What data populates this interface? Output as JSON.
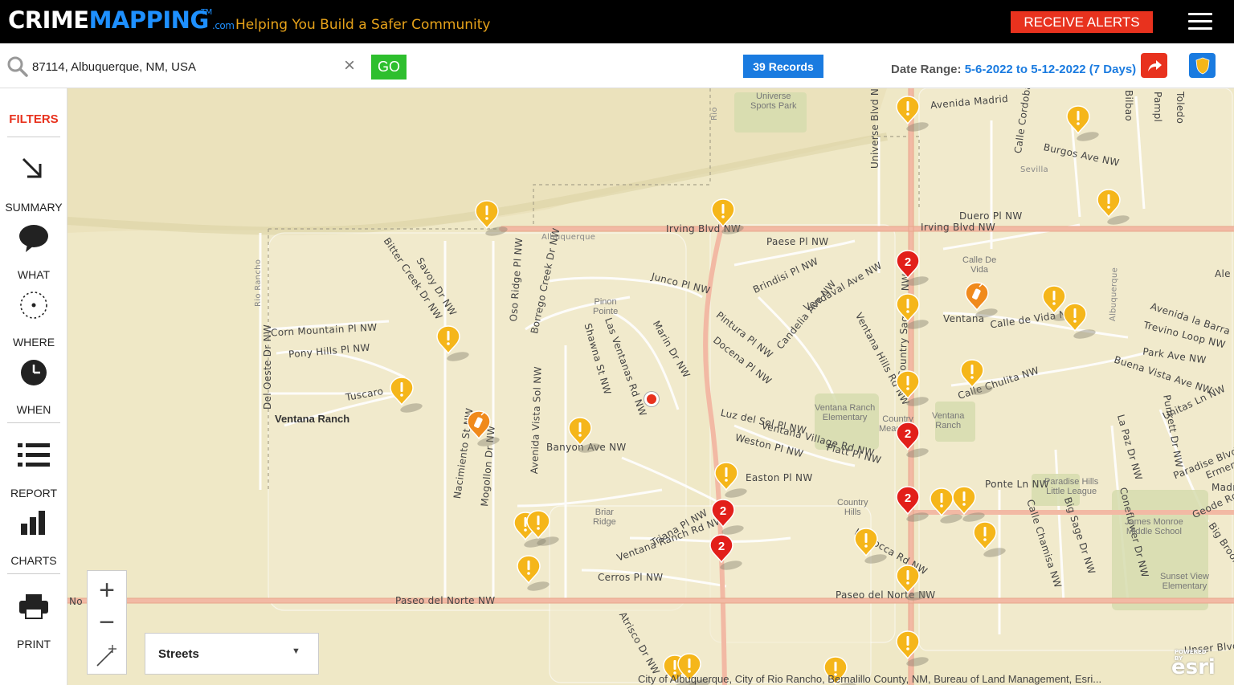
{
  "header": {
    "logo_crime": "CRIME",
    "logo_mapping": "MAPPING",
    "logo_tm": "TM",
    "logo_com": ".com",
    "tagline": "Helping You Build a Safer Community",
    "receive_alerts": "RECEIVE ALERTS"
  },
  "search": {
    "value": "87114, Albuquerque, NM, USA",
    "go_label": "GO",
    "records_label": "39 Records",
    "date_range_label": "Date Range:",
    "date_range_value": "5-6-2022 to 5-12-2022 (7 Days)"
  },
  "sidebar": {
    "filters": "FILTERS",
    "summary": "SUMMARY",
    "what": "WHAT",
    "where": "WHERE",
    "when": "WHEN",
    "report": "REPORT",
    "charts": "CHARTS",
    "print": "PRINT"
  },
  "map": {
    "basemap": "Streets",
    "attribution": "City of Albuquerque, City of Rio Rancho, Bernalillo County, NM, Bureau of Land Management, Esri...",
    "esri": "esri",
    "powered_by": "POWERED BY",
    "area_label": "Ventana Ranch",
    "streets": {
      "irving1": "Irving Blvd NW",
      "irving2": "Irving Blvd NW",
      "paseo1": "Paseo del Norte NW",
      "paseo2": "Paseo del Norte NW",
      "universe": "Universe Blvd NW",
      "avenida_madrid": "Avenida Madrid",
      "burgos": "Burgos Ave NW",
      "duero": "Duero Pl NW",
      "paese": "Paese Pl NW",
      "junco": "Junco Pl NW",
      "brindisi": "Brindisi Pl NW",
      "candelia": "Candelia Ave NW",
      "vendaval": "Vendaval Ave NW",
      "pintura": "Pintura Pl NW",
      "docena": "Docena Pl NW",
      "corn": "Corn Mountain Pl NW",
      "pony": "Pony Hills Pl NW",
      "tuscaro": "Tuscaro",
      "del_oeste": "Del Oeste Dr NW",
      "luz": "Luz del Sol Pl NW",
      "ventana_village": "Ventana Village Rd NW",
      "weston": "Weston Pl NW",
      "platt": "Platt Pl NW",
      "easton": "Easton Pl NW",
      "banyon": "Banyon Ave NW",
      "calle_vida": "Calle de Vida NW",
      "avenida_barra": "Avenida la Barra",
      "trevino": "Trevino Loop NW",
      "park": "Park Ave NW",
      "buena": "Buena Vista Ave NW",
      "unitas": "Unitas Ln NW",
      "paradise": "Paradise Blvd",
      "ponte": "Ponte Ln NW",
      "triana": "Triana Pl NW",
      "ventana_ranch_rd": "Ventana Ranch Rd NW",
      "la_rocca": "La Rocca Rd NW",
      "cerros": "Cerros Pl NW",
      "marin": "Marin Dr NW",
      "las_ventanas": "Las Ventanas Rd NW",
      "shawnee": "Shawna St NW",
      "nacimiento": "Nacimiento St NW",
      "mogollon": "Mogollon Dr NW",
      "avenida_vista": "Avenida Vista Sol NW",
      "oso": "Oso Ridge Pl NW",
      "borrego": "Borrego Creek Dr NW",
      "bitter": "Bitter Creek Dr NW",
      "savoy": "Savoy Dr NW",
      "country_sage": "Country Sage Dr NW",
      "calle_chulita": "Calle Chulita NW",
      "unser": "Unser Blvd",
      "ventana_hills": "Ventana Hills Rd NW",
      "la_paz": "La Paz Dr NW",
      "punkett": "Punkett Dr NW",
      "coneflower": "Coneflower Dr NW",
      "big_sage": "Big Sage Dr NW",
      "calle_chamisa": "Calle Chamisa NW",
      "geode": "Geode Rd",
      "rio_rancho": "Rio Rancho",
      "albuquerque": "Albuquerque",
      "albuquerque2": "Albuquerque",
      "rio": "Rio",
      "bilbao": "Bilbao",
      "toledo": "Toledo",
      "pamplona": "Pampl",
      "calle_cordoba": "Calle Cordoba",
      "sevilla": "Sevilla",
      "ventana_w": "Ventana",
      "ale": "Ale",
      "ermen": "Ermen",
      "madr": "Madr",
      "brick": "Big Brook",
      "no": "No",
      "atrisco": "Atrisco Dr NW",
      "unser_blvd": "Unser Blvd"
    },
    "places": {
      "universe_park": "Universe\nSports Park",
      "pinon": "Pinon\nPointe",
      "calle_de_vida": "Calle De\nVida",
      "ventana_ranch_elem": "Ventana Ranch\nElementary",
      "country_meadows": "Country\nMeadows",
      "ventana_ranch2": "Ventana\nRanch",
      "paradise_hills": "Paradise Hills\nLittle League",
      "james_monroe": "James Monroe\nMiddle School",
      "sunset_view": "Sunset View\nElementary",
      "brier_ridge": "Briar\nRidge",
      "country_hills": "Country\nHills",
      "ventana_vr": "Ventana"
    },
    "markers": [
      {
        "type": "warning",
        "count": ""
      },
      {
        "type": "cluster",
        "count": "2"
      }
    ],
    "colors": {
      "warning": "#f5b61a",
      "cluster": "#e21f1a",
      "vandalism": "#f08a1c",
      "major_road": "#f2b9a4"
    }
  }
}
